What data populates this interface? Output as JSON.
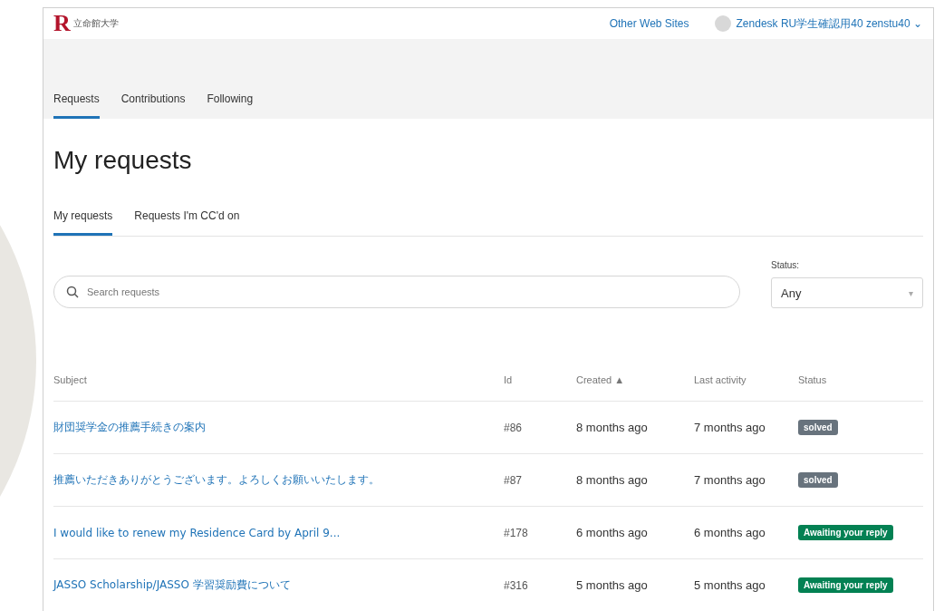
{
  "header": {
    "logo": {
      "letter": "R",
      "name": "立命館大学"
    },
    "links": [
      "Other Web Sites"
    ],
    "user": {
      "name": "Zendesk RU学生確認用40 zenstu40",
      "caret": "⌄"
    }
  },
  "nav_tabs": [
    {
      "label": "Requests",
      "selected": true
    },
    {
      "label": "Contributions",
      "selected": false
    },
    {
      "label": "Following",
      "selected": false
    }
  ],
  "page_title": "My requests",
  "request_tabs": [
    {
      "label": "My requests",
      "selected": true
    },
    {
      "label": "Requests I'm CC'd on",
      "selected": false
    }
  ],
  "search": {
    "placeholder": "Search requests"
  },
  "status_filter": {
    "label": "Status:",
    "value": "Any",
    "caret": "▾"
  },
  "table": {
    "columns": [
      "Subject",
      "Id",
      "Created ▲",
      "Last activity",
      "Status"
    ],
    "rows": [
      {
        "subject": "財団奨学金の推薦手続きの案内",
        "id": "#86",
        "created": "8 months ago",
        "last_activity": "7 months ago",
        "status": {
          "label": "solved",
          "color": "#68737d"
        }
      },
      {
        "subject": "推薦いただきありがとうございます。よろしくお願いいたします。",
        "id": "#87",
        "created": "8 months ago",
        "last_activity": "7 months ago",
        "status": {
          "label": "solved",
          "color": "#68737d"
        }
      },
      {
        "subject": "I would like to renew my Residence Card by April 9...",
        "id": "#178",
        "created": "6 months ago",
        "last_activity": "6 months ago",
        "status": {
          "label": "Awaiting your reply",
          "color": "#038153"
        }
      },
      {
        "subject": "JASSO Scholarship/JASSO 学習奨励費について",
        "id": "#316",
        "created": "5 months ago",
        "last_activity": "5 months ago",
        "status": {
          "label": "Awaiting your reply",
          "color": "#038153"
        }
      }
    ]
  }
}
